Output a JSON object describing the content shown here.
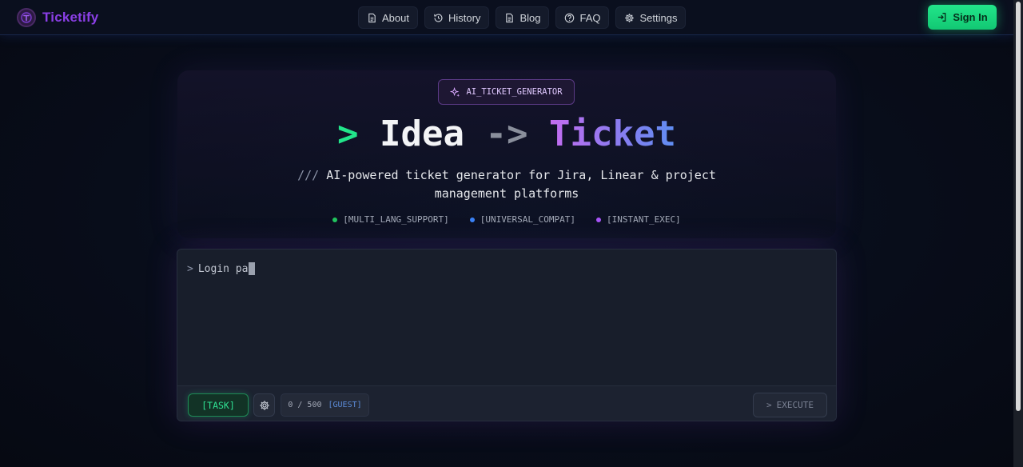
{
  "brand": {
    "name": "Ticketify",
    "logo_icon": "ticketify-logo-icon"
  },
  "nav": {
    "items": [
      {
        "label": "About",
        "icon": "document-icon"
      },
      {
        "label": "History",
        "icon": "history-icon"
      },
      {
        "label": "Blog",
        "icon": "document-icon"
      },
      {
        "label": "FAQ",
        "icon": "help-circle-icon"
      },
      {
        "label": "Settings",
        "icon": "gear-icon"
      }
    ],
    "signin_label": "Sign In"
  },
  "hero": {
    "badge": "AI_TICKET_GENERATOR",
    "headline": {
      "prompt": ">",
      "idea": "Idea",
      "arrow": "->",
      "ticket": "Ticket"
    },
    "subtitle_prefix": "///",
    "subtitle": "AI-powered ticket generator for Jira, Linear & project management platforms",
    "features": [
      {
        "label": "[MULTI_LANG_SUPPORT]",
        "color": "#22c55e"
      },
      {
        "label": "[UNIVERSAL_COMPAT]",
        "color": "#3b82f6"
      },
      {
        "label": "[INSTANT_EXEC]",
        "color": "#a855f7"
      }
    ]
  },
  "editor": {
    "prompt_symbol": ">",
    "value": "Login pa",
    "task_label": "[TASK]",
    "counter": "0 / 500",
    "guest_label": "[GUEST]",
    "execute_label": "EXECUTE",
    "execute_symbol": ">"
  },
  "colors": {
    "accent_green": "#22e58a",
    "brand_purple": "#8b3fe6",
    "background": "#070b16"
  }
}
